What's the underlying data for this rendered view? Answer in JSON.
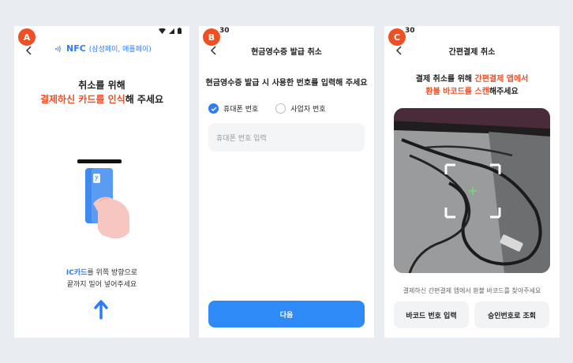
{
  "badges": {
    "a": "A",
    "b": "B",
    "c": "C"
  },
  "status": {
    "time_b": "30",
    "time_c": "30"
  },
  "screen_a": {
    "nfc_label": "NFC",
    "nfc_sub": "(삼성페이, 애플페이)",
    "headline_1": "취소를 위해",
    "headline_2_red": "결제하신 카드를 인식",
    "headline_2_rest": "해 주세요",
    "instruction_1_blue": "IC카드",
    "instruction_1_rest": "를 위쪽 방향으로",
    "instruction_2": "끝까지 밀어 넣어주세요"
  },
  "screen_b": {
    "title": "현금영수증 발급 취소",
    "prompt": "현금영수증 발급 시 사용한 번호를 입력해 주세요",
    "radio_phone": "휴대폰 번호",
    "radio_business": "사업자 번호",
    "input_placeholder": "휴대폰 번호 입력",
    "next_button": "다음"
  },
  "screen_c": {
    "title": "간편결제 취소",
    "line1_prefix": "결제 취소를 위해 ",
    "line1_red": "간편결제 앱에서",
    "line2_red": "환불 바코드를 스캔",
    "line2_rest": "해주세요",
    "hint": "결제하신 간편결제 앱에서 환불 바코드를 찾아주세요",
    "barcode_button": "바코드 번호 입력",
    "approval_button": "승인번호로 조회"
  },
  "colors": {
    "accent": "#2d8af6",
    "brand_red": "#f04e23"
  }
}
